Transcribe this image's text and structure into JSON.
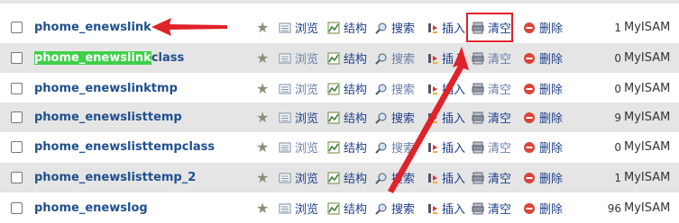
{
  "actions": {
    "browse": "浏览",
    "structure": "结构",
    "search": "搜索",
    "insert": "插入",
    "empty": "清空",
    "drop": "删除"
  },
  "rows": [
    {
      "name": "phome_enewslink",
      "rows": "1",
      "engine": "MyISAM",
      "disabled": false
    },
    {
      "name_highlight": "phome_enewslink",
      "name_rest": "class",
      "rows": "0",
      "engine": "MyISAM",
      "disabled": true
    },
    {
      "name": "phome_enewslinktmp",
      "rows": "0",
      "engine": "MyISAM",
      "disabled": true
    },
    {
      "name": "phome_enewslisttemp",
      "rows": "9",
      "engine": "MyISAM",
      "disabled": false
    },
    {
      "name": "phome_enewslisttempclass",
      "rows": "0",
      "engine": "MyISAM",
      "disabled": true
    },
    {
      "name": "phome_enewslisttemp_2",
      "rows": "1",
      "engine": "MyISAM",
      "disabled": false
    },
    {
      "name": "phome_enewslog",
      "rows": "96",
      "engine": "MyISAM",
      "disabled": false
    }
  ],
  "colors": {
    "row_odd": "#e5e5e5",
    "row_even": "#ffffff",
    "annotation_red": "#e0222a",
    "highlight_green": "#3fd04a"
  }
}
